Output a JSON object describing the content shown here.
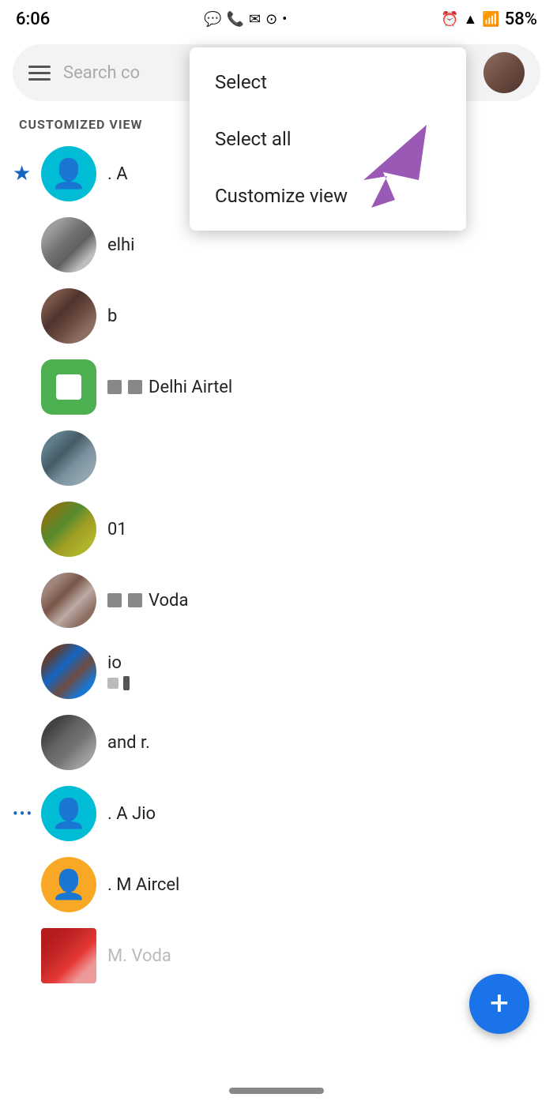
{
  "statusBar": {
    "time": "6:06",
    "batteryPercent": "58%"
  },
  "searchBar": {
    "placeholder": "Search co",
    "hamburgerLabel": "Menu"
  },
  "sectionLabel": "CUSTOMIZED VIEW",
  "contacts": [
    {
      "id": 1,
      "icon": "star",
      "avatarType": "cyan-person",
      "name": ". A",
      "namePartial": true
    },
    {
      "id": 2,
      "icon": "none",
      "avatarType": "thumb-grey",
      "name": "elhi",
      "namePartial": true
    },
    {
      "id": 3,
      "icon": "none",
      "avatarType": "thumb-brown",
      "name": "b",
      "namePartial": true
    },
    {
      "id": 4,
      "icon": "none",
      "avatarType": "green-app",
      "name": "Delhi Airtel",
      "hasBadge": true
    },
    {
      "id": 5,
      "icon": "none",
      "avatarType": "thumb-mixed",
      "name": "",
      "namePartial": true
    },
    {
      "id": 6,
      "icon": "none",
      "avatarType": "thumb-olive",
      "name": "01",
      "namePartial": true
    },
    {
      "id": 7,
      "icon": "none",
      "avatarType": "thumb-tan",
      "name": "Voda",
      "namePartial": true,
      "hasBadgeGrey": true
    },
    {
      "id": 8,
      "icon": "none",
      "avatarType": "thumb-blue-brown",
      "name": "io",
      "namePartial": true
    },
    {
      "id": 9,
      "icon": "none",
      "avatarType": "thumb-dark-grey",
      "name": "and r.",
      "namePartial": true
    },
    {
      "id": 10,
      "icon": "dots",
      "avatarType": "cyan-person",
      "name": ". A Jio"
    },
    {
      "id": 11,
      "icon": "none",
      "avatarType": "yellow-person",
      "name": ". M Aircel"
    },
    {
      "id": 12,
      "icon": "none",
      "avatarType": "thumb-red",
      "name": "M. Voda",
      "nameGrey": true
    }
  ],
  "dropdown": {
    "items": [
      {
        "id": "select",
        "label": "Select"
      },
      {
        "id": "select-all",
        "label": "Select all"
      },
      {
        "id": "customize-view",
        "label": "Customize view"
      }
    ]
  },
  "fab": {
    "label": "+"
  }
}
